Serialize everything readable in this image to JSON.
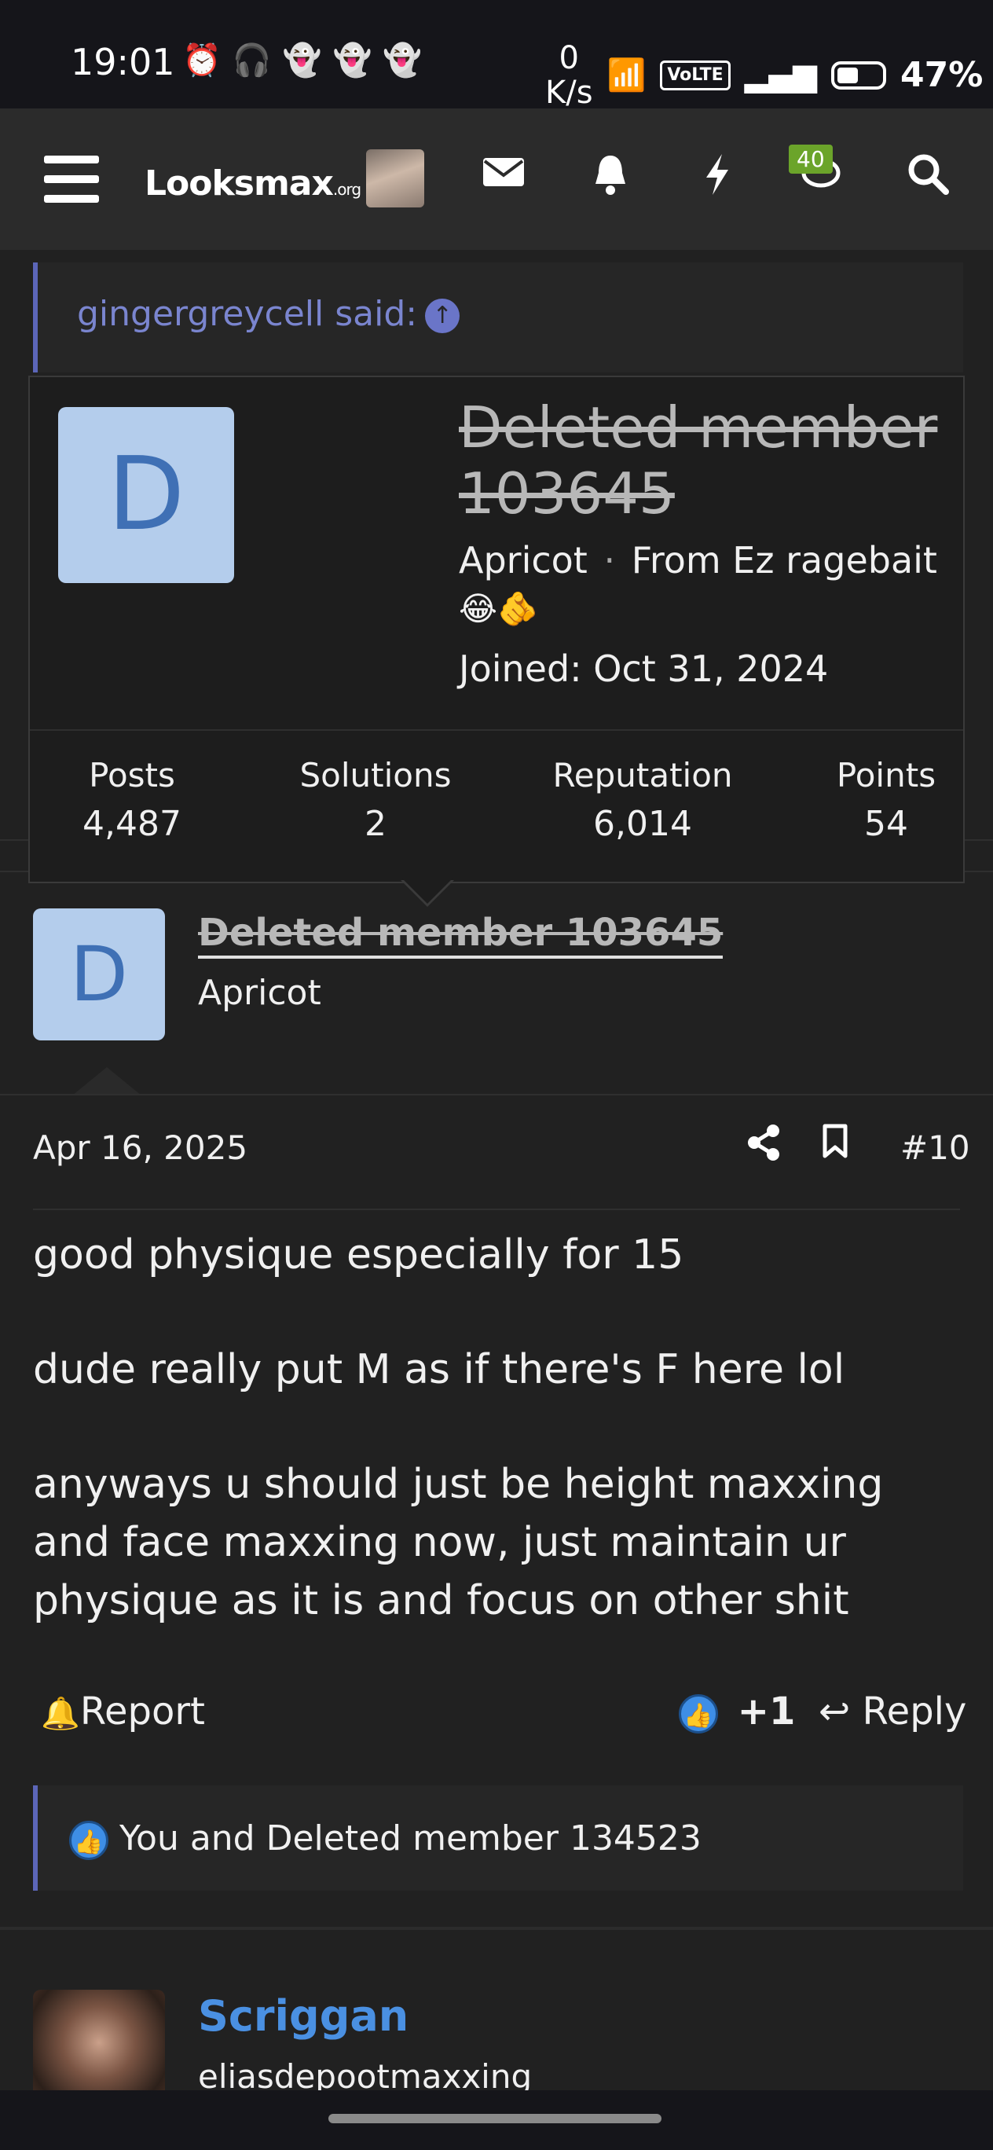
{
  "status_bar": {
    "time": "19:01",
    "net_speed_value": "0",
    "net_speed_unit": "K/s",
    "volte": "VoLTE",
    "battery": "47%"
  },
  "nav": {
    "logo_main": "Looksmax",
    "logo_suffix": ".org",
    "badge": "40"
  },
  "quote": {
    "text": "gingergreycell said:"
  },
  "card": {
    "avatar_letter": "D",
    "name": "Deleted member 103645",
    "title": "Apricot",
    "location": "From Ez ragebait",
    "emoji": "😂🫵",
    "joined": "Joined: Oct 31, 2024",
    "stats": [
      {
        "label": "Posts",
        "value": "4,487"
      },
      {
        "label": "Solutions",
        "value": "2"
      },
      {
        "label": "Reputation",
        "value": "6,014"
      },
      {
        "label": "Points",
        "value": "54"
      }
    ]
  },
  "post": {
    "avatar_letter": "D",
    "author": "Deleted member 103645",
    "title": "Apricot",
    "date": "Apr 16, 2025",
    "number": "#10",
    "paragraphs": [
      "good physique especially for 15",
      "dude really put M as if there's F here lol",
      "anyways u should just be height maxxing and face maxxing now, just maintain ur physique as it is and focus on other shit"
    ],
    "report": "Report",
    "like_count": "+1",
    "reply": "Reply",
    "reactions": "You and Deleted member 134523"
  },
  "next_post": {
    "author": "Scriggan",
    "title": "eliasdepootmaxxing"
  }
}
